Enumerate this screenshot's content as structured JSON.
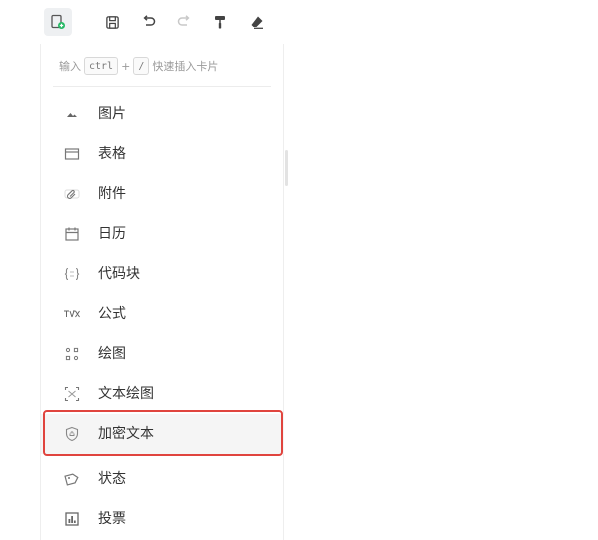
{
  "toolbar": {
    "buttons": [
      {
        "icon": "insert-card-icon",
        "active": true
      },
      {
        "icon": "save-icon"
      },
      {
        "icon": "undo-icon"
      },
      {
        "icon": "redo-icon"
      },
      {
        "icon": "format-painter-icon"
      },
      {
        "icon": "eraser-icon"
      }
    ]
  },
  "menu": {
    "hint": {
      "prefix": "输入",
      "key1": "ctrl",
      "plus": "+",
      "key2": "/",
      "suffix": "快速插入卡片"
    },
    "items": [
      {
        "label": "图片",
        "icon": "image-icon"
      },
      {
        "label": "表格",
        "icon": "table-icon"
      },
      {
        "label": "附件",
        "icon": "attachment-icon"
      },
      {
        "label": "日历",
        "icon": "calendar-icon"
      },
      {
        "label": "代码块",
        "icon": "code-block-icon"
      },
      {
        "label": "公式",
        "icon": "formula-icon"
      },
      {
        "label": "绘图",
        "icon": "drawing-icon"
      },
      {
        "label": "文本绘图",
        "icon": "text-drawing-icon"
      },
      {
        "label": "加密文本",
        "icon": "encrypted-text-icon"
      },
      {
        "label": "状态",
        "icon": "status-icon"
      },
      {
        "label": "投票",
        "icon": "vote-icon"
      }
    ]
  },
  "colors": {
    "accent": "#25b864",
    "highlight_border": "#e0443e"
  }
}
